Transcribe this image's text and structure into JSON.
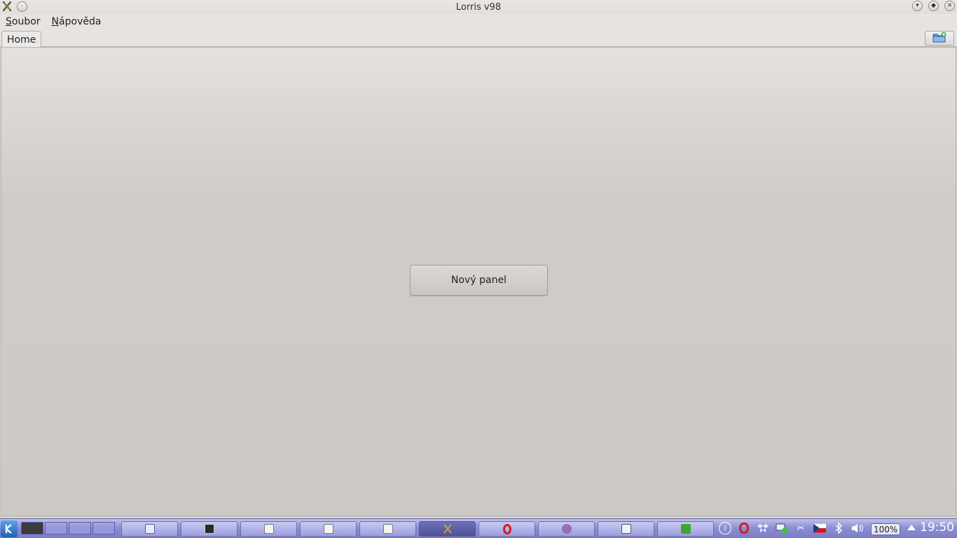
{
  "window": {
    "title": "Lorris v98"
  },
  "menu": {
    "items": [
      {
        "label_first": "S",
        "label_rest": "oubor"
      },
      {
        "label_first": "N",
        "label_rest": "ápověda"
      }
    ]
  },
  "tabs": {
    "items": [
      {
        "label": "Home"
      }
    ],
    "new_tab_icon": "folder-add-icon"
  },
  "main": {
    "new_panel_label": "Nový panel"
  },
  "taskbar": {
    "zoom_label": "100%",
    "clock": "19:50",
    "task_icons": [
      "notes-icon",
      "terminal-icon",
      "document-icon",
      "document-icon",
      "document-icon",
      "lorris-icon",
      "opera-icon",
      "pidgin-icon",
      "network-icon",
      "qt-icon"
    ],
    "tray_icons": [
      "info-icon",
      "opera-icon",
      "dropbox-icon",
      "network-status-icon",
      "scissors-icon",
      "czech-flag-icon",
      "bluetooth-icon",
      "volume-icon"
    ]
  },
  "colors": {
    "taskbar_top": "#bfc0ea",
    "taskbar_bottom": "#7a7cc8",
    "content_bg": "#cdc9c5"
  }
}
